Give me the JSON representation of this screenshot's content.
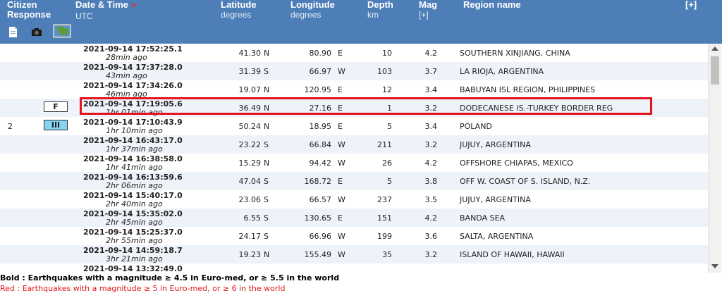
{
  "header": {
    "citizen_line1": "Citizen",
    "citizen_line2": "Response",
    "date_time": "Date & Time",
    "utc": "UTC",
    "latitude": "Latitude",
    "latitude_unit": "degrees",
    "longitude": "Longitude",
    "longitude_unit": "degrees",
    "depth": "Depth",
    "depth_unit": "km",
    "mag": "Mag",
    "mag_expand": "[+]",
    "region": "Region name",
    "expand_all": "[+]",
    "sort_glyph": "▼",
    "icons": [
      "document-icon",
      "camera-icon",
      "map-icon"
    ]
  },
  "colors": {
    "header_bg": "#4d7eb8",
    "date_link": "#2b2bc4",
    "row_alt": "#eef3fa",
    "highlight": "#e4141e",
    "legend_red": "#e01818"
  },
  "rows": [
    {
      "count": "",
      "badge": "",
      "date": "2021-09-14   17:52:25.1",
      "ago": "28min ago",
      "lat": "41.30",
      "lat_dir": "N",
      "lon": "80.90",
      "lon_dir": "E",
      "depth": "10",
      "mag": "4.2",
      "region": "SOUTHERN XINJIANG, CHINA"
    },
    {
      "count": "",
      "badge": "",
      "date": "2021-09-14   17:37:28.0",
      "ago": "43min ago",
      "lat": "31.39",
      "lat_dir": "S",
      "lon": "66.97",
      "lon_dir": "W",
      "depth": "103",
      "mag": "3.7",
      "region": "LA RIOJA, ARGENTINA"
    },
    {
      "count": "",
      "badge": "",
      "date": "2021-09-14   17:34:26.0",
      "ago": "46min ago",
      "lat": "19.07",
      "lat_dir": "N",
      "lon": "120.95",
      "lon_dir": "E",
      "depth": "12",
      "mag": "3.4",
      "region": "BABUYAN ISL REGION, PHILIPPINES"
    },
    {
      "count": "",
      "badge": "F",
      "date": "2021-09-14   17:19:05.6",
      "ago": "1hr 01min ago",
      "lat": "36.49",
      "lat_dir": "N",
      "lon": "27.16",
      "lon_dir": "E",
      "depth": "1",
      "mag": "3.2",
      "region": "DODECANESE IS.-TURKEY BORDER REG"
    },
    {
      "count": "2",
      "badge": "III",
      "date": "2021-09-14   17:10:43.9",
      "ago": "1hr 10min ago",
      "lat": "50.24",
      "lat_dir": "N",
      "lon": "18.95",
      "lon_dir": "E",
      "depth": "5",
      "mag": "3.4",
      "region": "POLAND"
    },
    {
      "count": "",
      "badge": "",
      "date": "2021-09-14   16:43:17.0",
      "ago": "1hr 37min ago",
      "lat": "23.22",
      "lat_dir": "S",
      "lon": "66.84",
      "lon_dir": "W",
      "depth": "211",
      "mag": "3.2",
      "region": "JUJUY, ARGENTINA"
    },
    {
      "count": "",
      "badge": "",
      "date": "2021-09-14   16:38:58.0",
      "ago": "1hr 41min ago",
      "lat": "15.29",
      "lat_dir": "N",
      "lon": "94.42",
      "lon_dir": "W",
      "depth": "26",
      "mag": "4.2",
      "region": "OFFSHORE CHIAPAS, MEXICO"
    },
    {
      "count": "",
      "badge": "",
      "date": "2021-09-14   16:13:59.6",
      "ago": "2hr 06min ago",
      "lat": "47.04",
      "lat_dir": "S",
      "lon": "168.72",
      "lon_dir": "E",
      "depth": "5",
      "mag": "3.8",
      "region": "OFF W. COAST OF S. ISLAND, N.Z."
    },
    {
      "count": "",
      "badge": "",
      "date": "2021-09-14   15:40:17.0",
      "ago": "2hr 40min ago",
      "lat": "23.06",
      "lat_dir": "S",
      "lon": "66.57",
      "lon_dir": "W",
      "depth": "237",
      "mag": "3.5",
      "region": "JUJUY, ARGENTINA"
    },
    {
      "count": "",
      "badge": "",
      "date": "2021-09-14   15:35:02.0",
      "ago": "2hr 45min ago",
      "lat": "6.55",
      "lat_dir": "S",
      "lon": "130.65",
      "lon_dir": "E",
      "depth": "151",
      "mag": "4.2",
      "region": "BANDA SEA"
    },
    {
      "count": "",
      "badge": "",
      "date": "2021-09-14   15:25:37.0",
      "ago": "2hr 55min ago",
      "lat": "24.17",
      "lat_dir": "S",
      "lon": "66.96",
      "lon_dir": "W",
      "depth": "199",
      "mag": "3.6",
      "region": "SALTA, ARGENTINA"
    },
    {
      "count": "",
      "badge": "",
      "date": "2021-09-14   14:59:18.7",
      "ago": "3hr 21min ago",
      "lat": "19.23",
      "lat_dir": "N",
      "lon": "155.49",
      "lon_dir": "W",
      "depth": "35",
      "mag": "3.2",
      "region": "ISLAND OF HAWAII, HAWAII"
    },
    {
      "count": "",
      "badge": "",
      "date": "2021-09-14   13:32:49.0",
      "ago": "",
      "lat": "",
      "lat_dir": "",
      "lon": "",
      "lon_dir": "",
      "depth": "",
      "mag": "",
      "region": ""
    }
  ],
  "legend": {
    "bold_text": "Bold : Earthquakes with a magnitude ≥ 4.5 in Euro-med, or ≥ 5.5 in the world",
    "red_text": "Red : Earthquakes with a magnitude ≥ 5 in Euro-med, or ≥ 6 in the world"
  }
}
